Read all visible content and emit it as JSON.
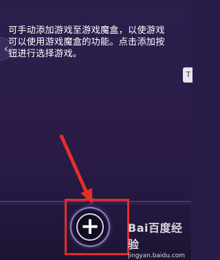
{
  "description": {
    "line1": "可手动添加游戏至游戏魔盒，以使游戏",
    "line2": "可以使用游戏魔盒的功能。点击添加按",
    "line3": "钮进行选择游戏。"
  },
  "back_button": {
    "icon": "chevron-left-icon",
    "glyph": "‹"
  },
  "side_tab": {
    "text": "T"
  },
  "add_button": {
    "icon": "plus-icon",
    "glyph": "+"
  },
  "annotation": {
    "color": "#e62d2a"
  },
  "watermark": {
    "main": "Bai百度经验",
    "sub": "jingyan.baidu.com"
  }
}
